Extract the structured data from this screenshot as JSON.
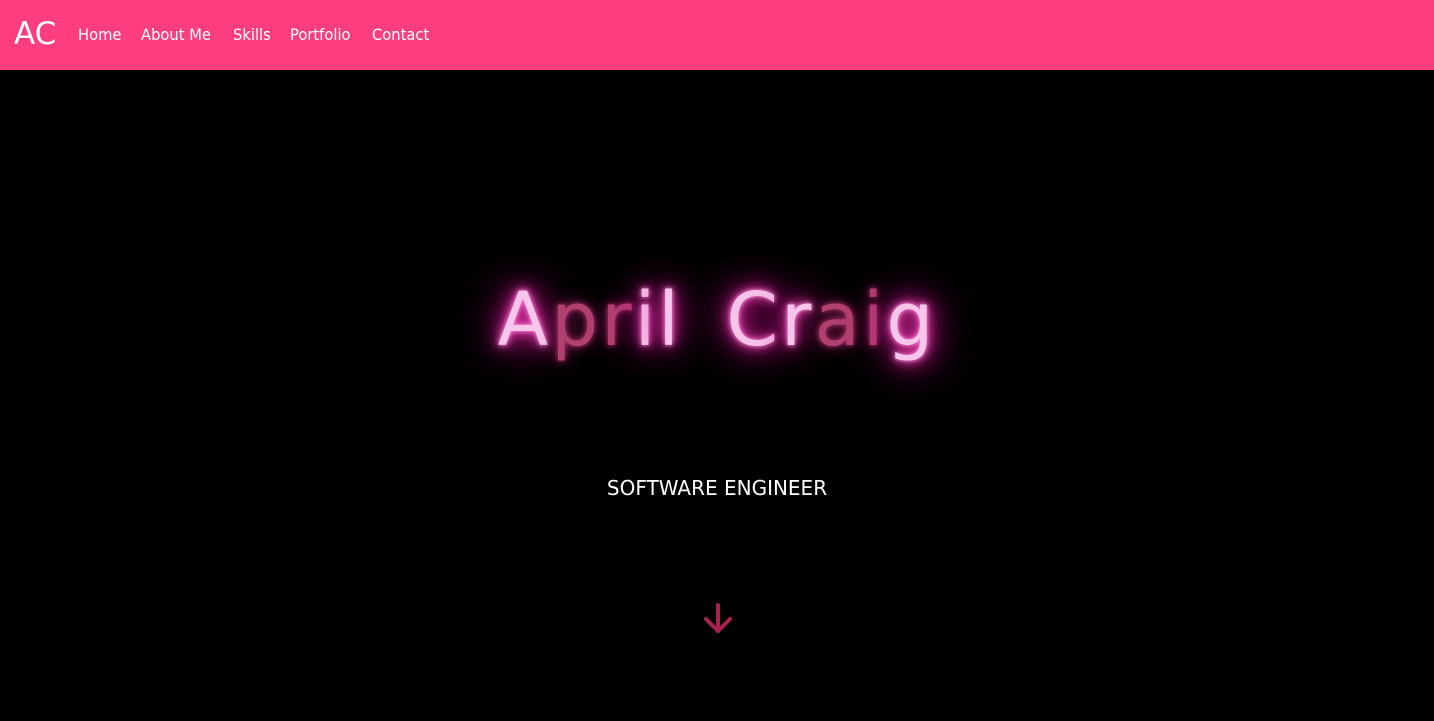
{
  "navbar": {
    "brand": "AC",
    "links": [
      {
        "label": "Home"
      },
      {
        "label": "About Me"
      },
      {
        "label": "Skills"
      },
      {
        "label": "Portfolio"
      },
      {
        "label": "Contact"
      }
    ],
    "background_color": "#ff3d7f"
  },
  "hero": {
    "name": "April Craig",
    "name_first": "April",
    "name_last": "Craig",
    "subtitle": "SOFTWARE ENGINEER",
    "background_color": "#000000",
    "glow_color": "#ff2fb0",
    "scroll_icon": "arrow-down-icon",
    "scroll_icon_color": "#a8224f"
  }
}
